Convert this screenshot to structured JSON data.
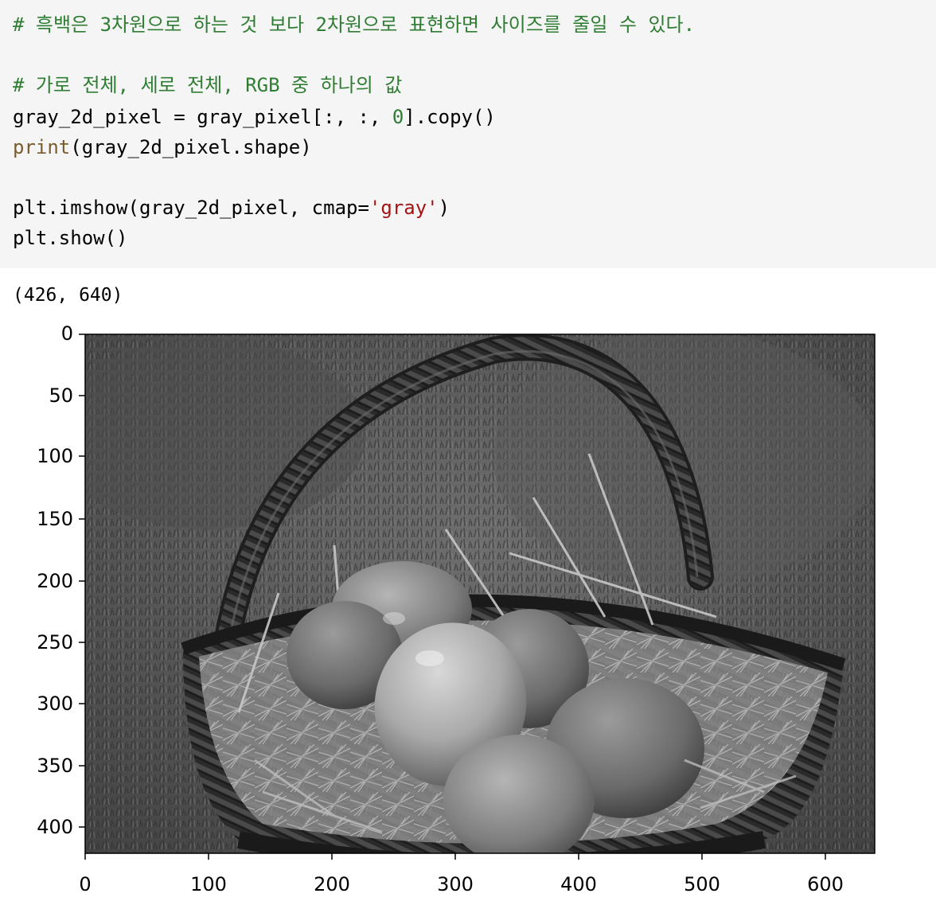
{
  "code_cell": {
    "line1_comment": "# 흑백은 3차원으로 하는 것 보다 2차원으로 표현하면 사이즈를 줄일 수 있다.",
    "line3_comment": "# 가로 전체, 세로 전체, RGB 중 하나의 값",
    "line4_prefix": "gray_2d_pixel = gray_pixel[:, :, ",
    "line4_number": "0",
    "line4_suffix": "].copy()",
    "line5_builtin": "print",
    "line5_rest": "(gray_2d_pixel.shape)",
    "line7_prefix": "plt.imshow(gray_2d_pixel, cmap=",
    "line7_string": "'gray'",
    "line7_suffix": ")",
    "line8": "plt.show()"
  },
  "output": {
    "shape_text": "(426, 640)"
  },
  "chart_data": {
    "type": "image",
    "colormap": "gray",
    "image_shape": [
      426,
      640
    ],
    "description_content": "grayscale photo of a wicker basket with straw and dyed eggs on grass",
    "x_ticks": [
      "0",
      "100",
      "200",
      "300",
      "400",
      "500",
      "600"
    ],
    "y_ticks": [
      "0",
      "50",
      "100",
      "150",
      "200",
      "250",
      "300",
      "350",
      "400"
    ],
    "xlim": [
      0,
      640
    ],
    "ylim": [
      426,
      0
    ]
  }
}
